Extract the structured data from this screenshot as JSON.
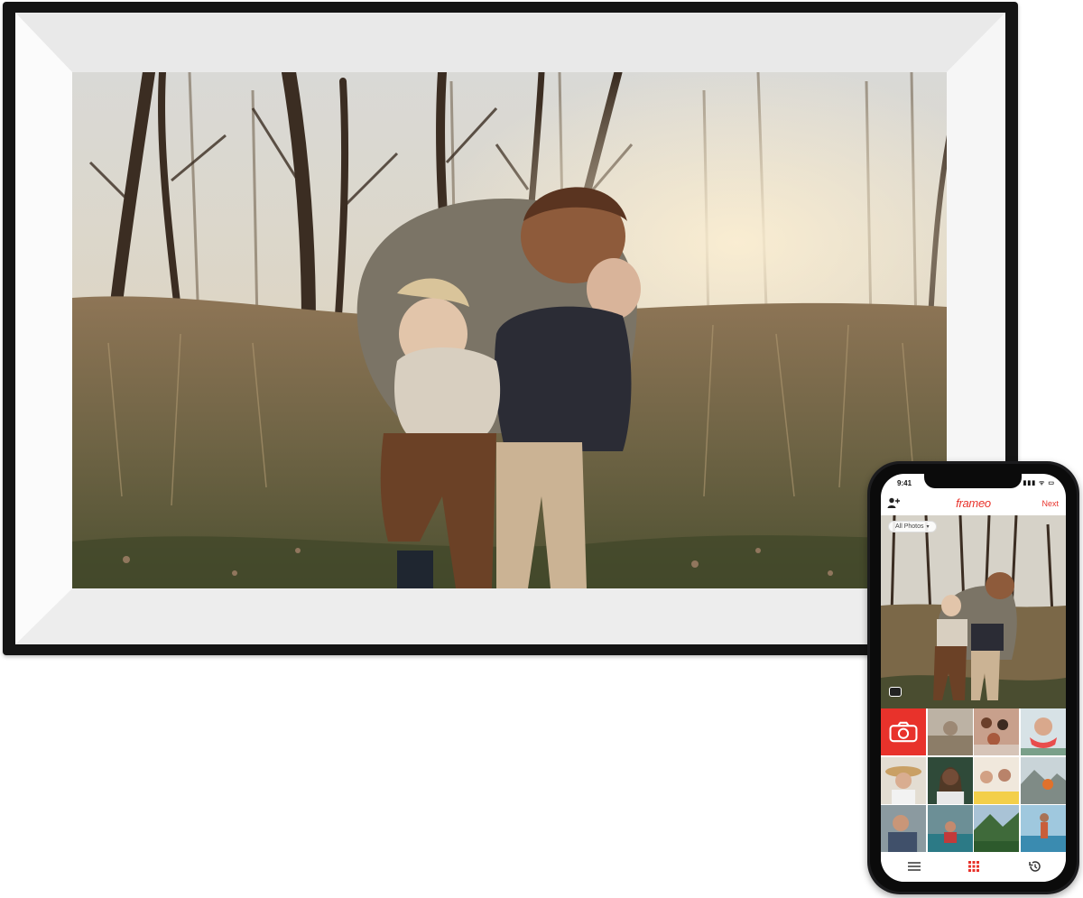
{
  "phone": {
    "status_time": "9:41",
    "status_icons": "▮▮▮ ᯤ ▭",
    "app_logo": "frameo",
    "next_label": "Next",
    "filter_label": "All Photos",
    "filter_caret": "▾",
    "icons": {
      "add_user": "add-user-icon",
      "camera": "camera-icon",
      "menu": "menu-icon",
      "apps": "grid-icon",
      "history": "history-icon",
      "select": "gallery-icon"
    }
  },
  "colors": {
    "accent": "#e8322b",
    "frame": "#141414",
    "mat": "#ffffff"
  }
}
